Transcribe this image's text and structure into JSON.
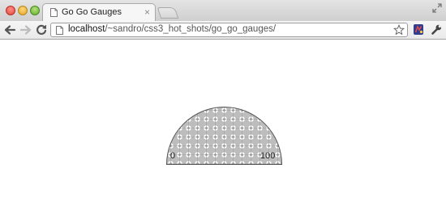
{
  "browser": {
    "tab": {
      "title": "Go Go Gauges"
    },
    "address": {
      "host": "localhost",
      "path": "/~sandro/css3_hot_shots/go_go_gauges/"
    }
  },
  "icons": {
    "traffic": [
      "close-window",
      "minimize-window",
      "maximize-window"
    ],
    "nav": [
      "back-arrow",
      "forward-arrow",
      "reload"
    ],
    "tab_close": "×"
  },
  "gauge": {
    "min_label": "0",
    "max_label": "100",
    "colors": {
      "fill": "#b8b8b8",
      "outline": "#555555"
    }
  }
}
